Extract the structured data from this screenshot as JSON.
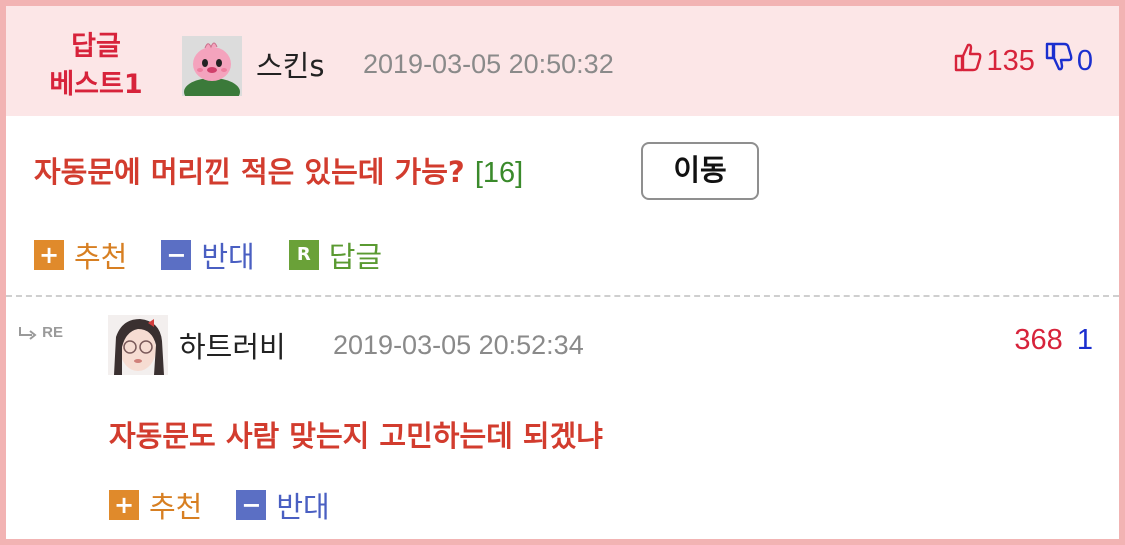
{
  "best_comment": {
    "badge_line1": "답글",
    "badge_line2": "베스트1",
    "author": "스킨s",
    "date": "2019-03-05 20:50:32",
    "upvotes": "135",
    "downvotes": "0",
    "title": "자동문에 머리낀 적은 있는데 가능?",
    "reply_count": "[16]",
    "move_button": "이동",
    "actions": {
      "recommend": "추천",
      "oppose": "반대",
      "reply": "답글"
    }
  },
  "reply": {
    "re_label": "RE",
    "author": "하트러비",
    "date": "2019-03-05 20:52:34",
    "upvotes": "368",
    "downvotes": "1",
    "text": "자동문도 사람 맞는지 고민하는데 되겠냐",
    "actions": {
      "recommend": "추천",
      "oppose": "반대"
    }
  },
  "colors": {
    "frame": "#f2b3b3",
    "header_bg": "#fce6e7",
    "accent_red": "#d7233b",
    "title_red": "#d23c2e",
    "blue": "#1b2fcf",
    "plus_orange": "#e08a2b",
    "minus_blue": "#5b6fc4",
    "reply_green": "#6aa138"
  },
  "icons": {
    "thumb_up": "thumbs-up-icon",
    "thumb_down": "thumbs-down-icon",
    "plus": "plus-icon",
    "minus": "minus-icon",
    "reply": "reply-r-icon",
    "re_arrow": "reply-arrow-icon"
  }
}
